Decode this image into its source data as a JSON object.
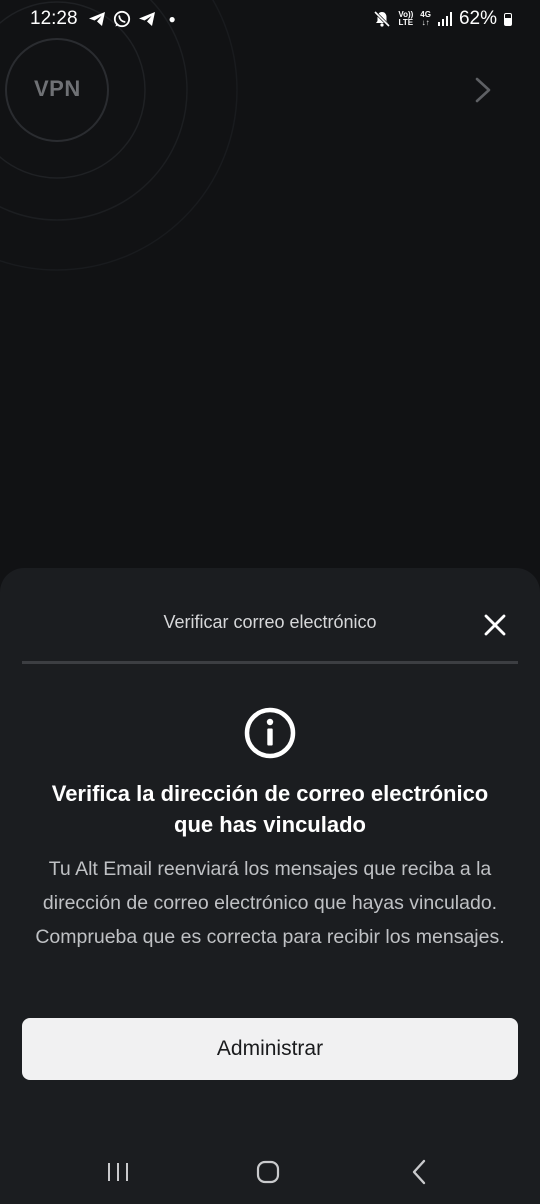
{
  "status_bar": {
    "time": "12:28",
    "notification_icons": [
      "telegram-icon",
      "whatsapp-icon",
      "telegram-icon"
    ],
    "volte_top": "Vo))",
    "volte_bottom": "LTE",
    "network_top": "4G",
    "network_bottom": "↓↑",
    "battery": "62%"
  },
  "background": {
    "vpn_label": "VPN"
  },
  "sheet": {
    "title": "Verificar correo electrónico",
    "heading": "Verifica la dirección de correo electrónico que has vinculado",
    "body": "Tu Alt Email reenviará los mensajes que reciba a la dirección de correo electrónico que hayas vinculado. Comprueba que es correcta para recibir los mensajes.",
    "button_label": "Administrar"
  },
  "colors": {
    "background": "#111214",
    "sheet": "#1b1d20",
    "button": "#f1f1f2"
  }
}
